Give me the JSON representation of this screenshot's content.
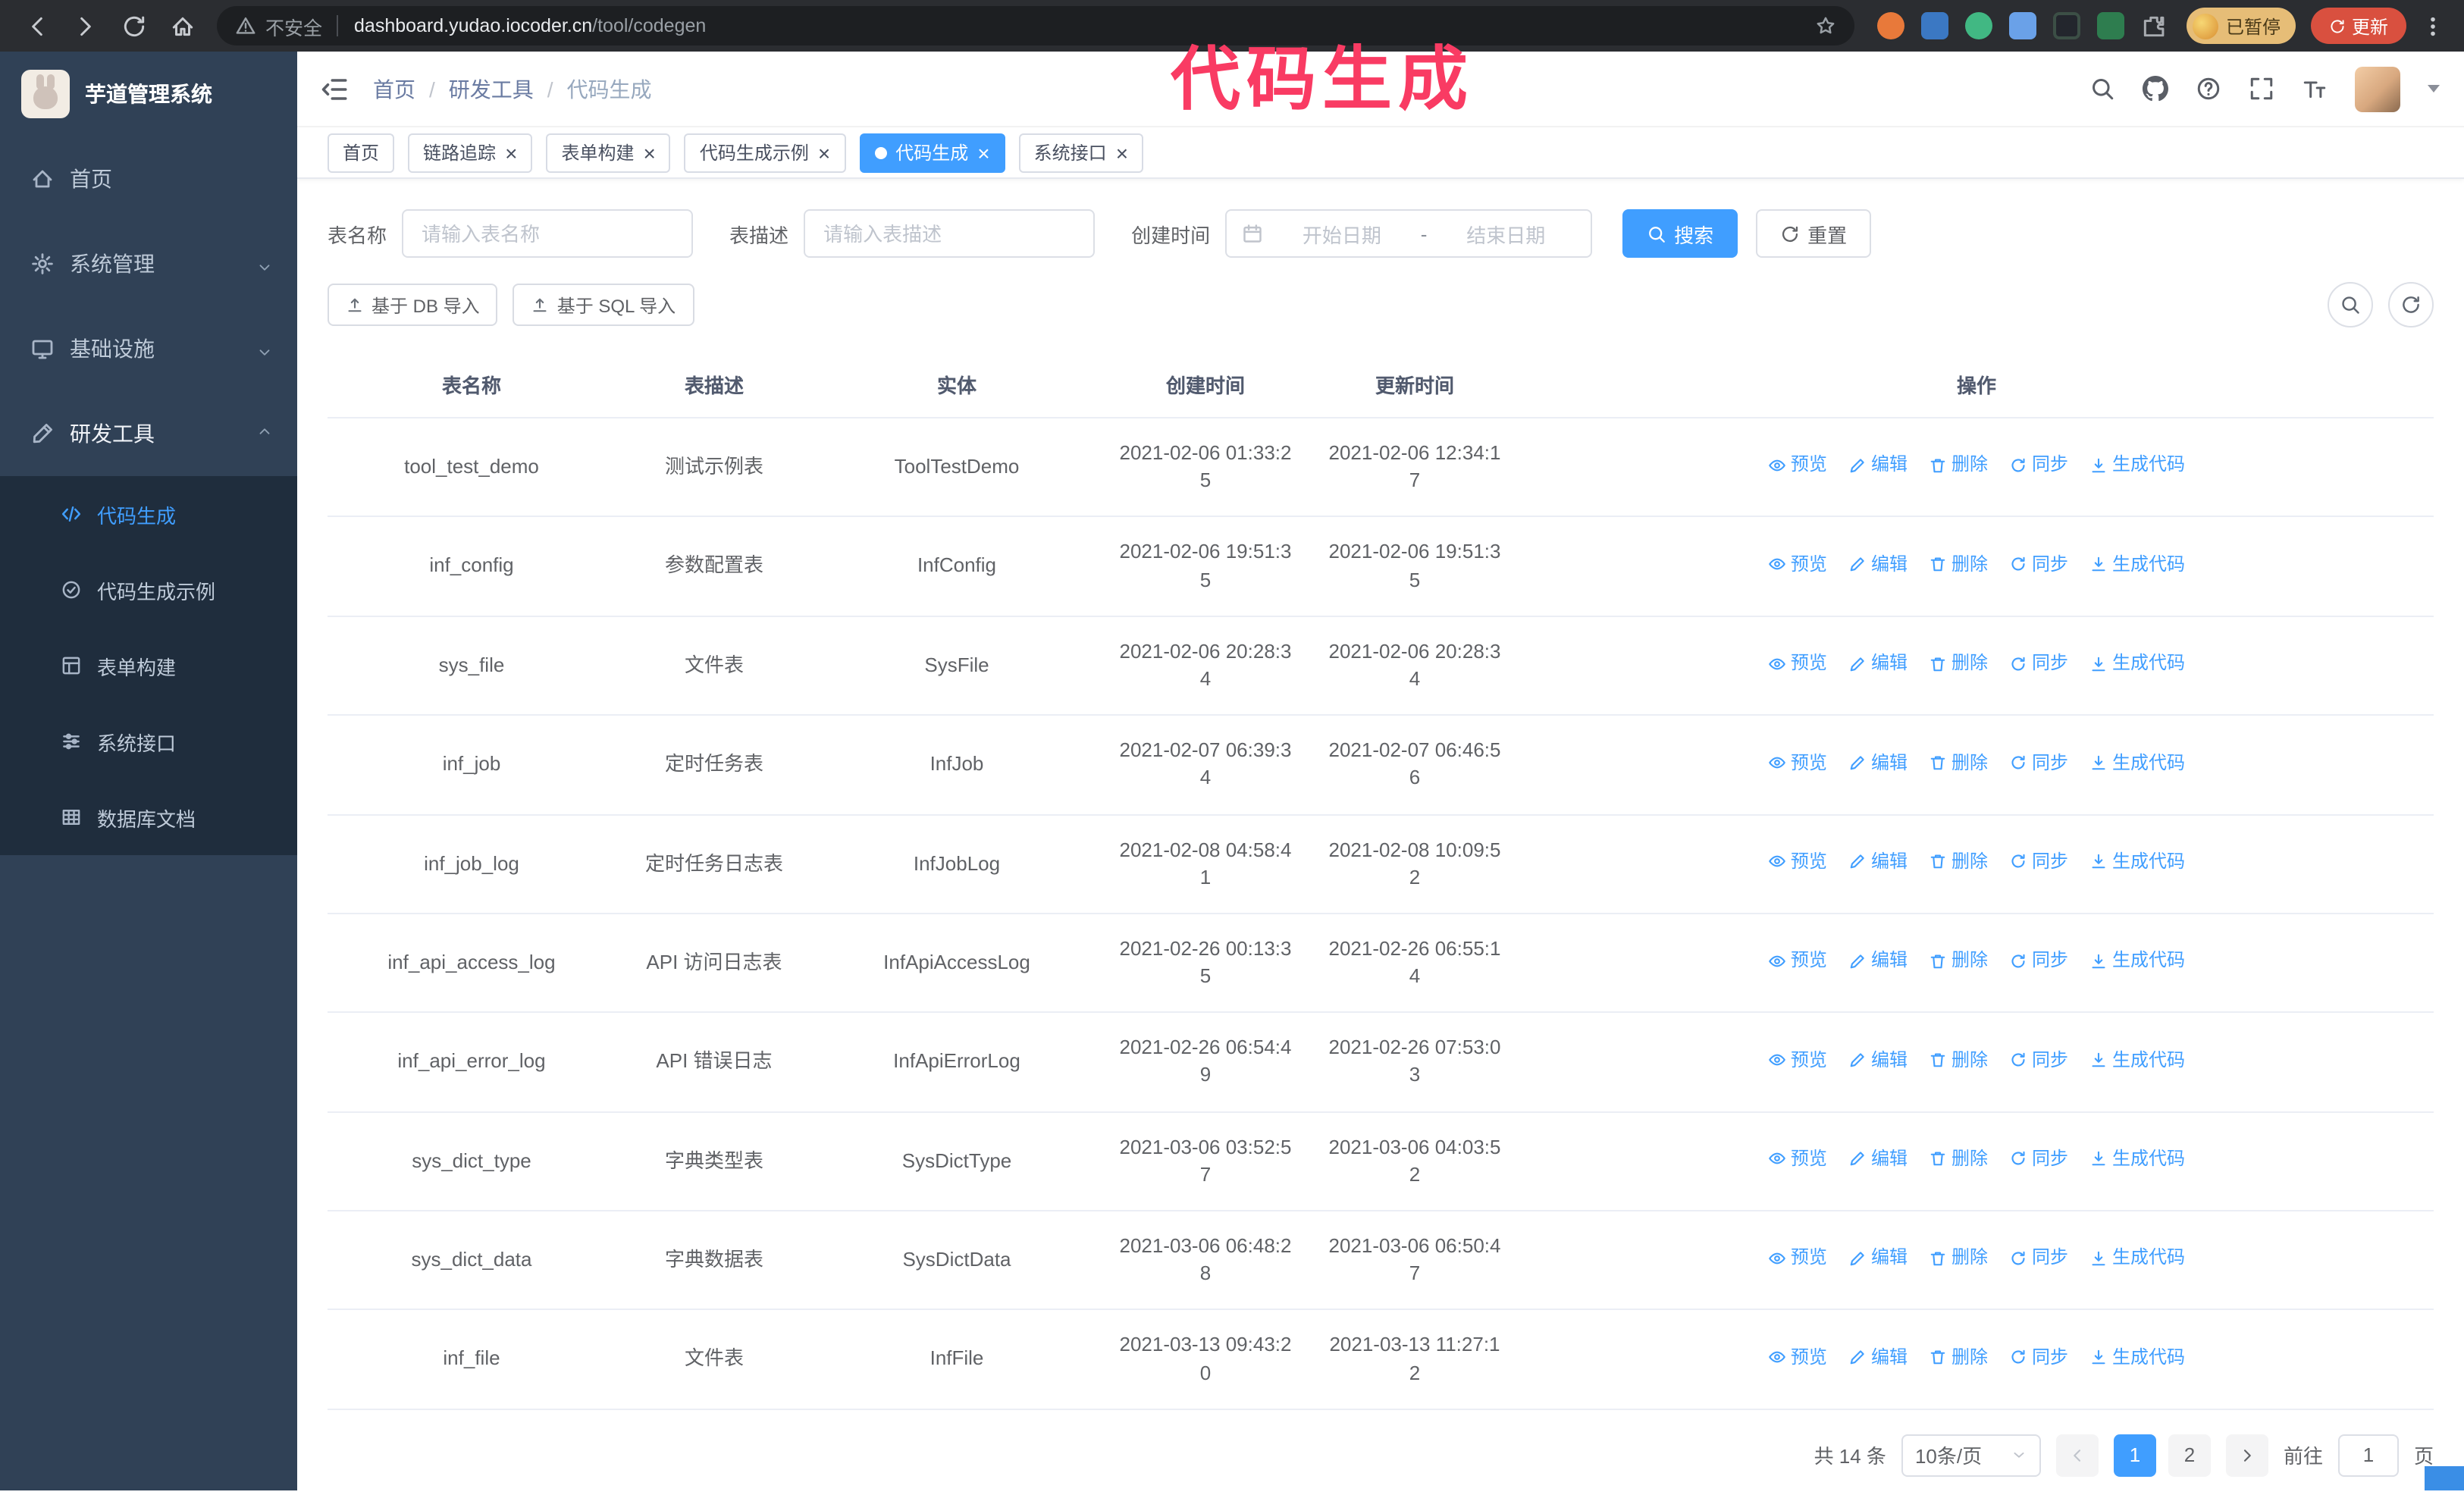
{
  "browser": {
    "security_label": "不安全",
    "url_domain": "dashboard.yudao.iocoder.cn",
    "url_path": "/tool/codegen",
    "profile_badge": "已暂停",
    "update_label": "更新"
  },
  "annotation": {
    "text": "代码生成",
    "color": "#f93b63"
  },
  "sidebar": {
    "title": "芋道管理系统",
    "items": [
      {
        "key": "home",
        "label": "首页",
        "icon": "home-icon",
        "expandable": false,
        "expanded": false
      },
      {
        "key": "system",
        "label": "系统管理",
        "icon": "gear-icon",
        "expandable": true,
        "expanded": false
      },
      {
        "key": "infra",
        "label": "基础设施",
        "icon": "monitor-icon",
        "expandable": true,
        "expanded": false
      },
      {
        "key": "dev-tools",
        "label": "研发工具",
        "icon": "tools-icon",
        "expandable": true,
        "expanded": true
      }
    ],
    "sub_items": [
      {
        "key": "codegen",
        "label": "代码生成",
        "icon": "code-icon",
        "active": true
      },
      {
        "key": "codegen-example",
        "label": "代码生成示例",
        "icon": "example-icon",
        "active": false
      },
      {
        "key": "form-builder",
        "label": "表单构建",
        "icon": "form-icon",
        "active": false
      },
      {
        "key": "system-api",
        "label": "系统接口",
        "icon": "api-icon",
        "active": false
      },
      {
        "key": "db-doc",
        "label": "数据库文档",
        "icon": "db-doc-icon",
        "active": false
      }
    ]
  },
  "navbar": {
    "breadcrumb": [
      "首页",
      "研发工具",
      "代码生成"
    ]
  },
  "tabs": [
    {
      "key": "home",
      "label": "首页",
      "closable": false,
      "active": false
    },
    {
      "key": "tracer",
      "label": "链路追踪",
      "closable": true,
      "active": false
    },
    {
      "key": "form-builder",
      "label": "表单构建",
      "closable": true,
      "active": false
    },
    {
      "key": "codegen-example",
      "label": "代码生成示例",
      "closable": true,
      "active": false
    },
    {
      "key": "codegen",
      "label": "代码生成",
      "closable": true,
      "active": true
    },
    {
      "key": "system-api",
      "label": "系统接口",
      "closable": true,
      "active": false
    }
  ],
  "filters": {
    "table_name_label": "表名称",
    "table_name_placeholder": "请输入表名称",
    "table_desc_label": "表描述",
    "table_desc_placeholder": "请输入表描述",
    "create_time_label": "创建时间",
    "date_start_placeholder": "开始日期",
    "date_separator": "-",
    "date_end_placeholder": "结束日期",
    "search_label": "搜索",
    "reset_label": "重置"
  },
  "toolbar": {
    "import_db_label": "基于 DB 导入",
    "import_sql_label": "基于 SQL 导入"
  },
  "table": {
    "columns": [
      "表名称",
      "表描述",
      "实体",
      "创建时间",
      "更新时间",
      "操作"
    ],
    "actions": [
      {
        "key": "preview",
        "label": "预览",
        "icon": "eye-icon"
      },
      {
        "key": "edit",
        "label": "编辑",
        "icon": "edit-icon"
      },
      {
        "key": "delete",
        "label": "删除",
        "icon": "delete-icon"
      },
      {
        "key": "sync",
        "label": "同步",
        "icon": "sync-icon"
      },
      {
        "key": "generate",
        "label": "生成代码",
        "icon": "download-icon"
      }
    ],
    "rows": [
      {
        "name": "tool_test_demo",
        "desc": "测试示例表",
        "entity": "ToolTestDemo",
        "create_time": "2021-02-06 01:33:25",
        "update_time": "2021-02-06 12:34:17"
      },
      {
        "name": "inf_config",
        "desc": "参数配置表",
        "entity": "InfConfig",
        "create_time": "2021-02-06 19:51:35",
        "update_time": "2021-02-06 19:51:35"
      },
      {
        "name": "sys_file",
        "desc": "文件表",
        "entity": "SysFile",
        "create_time": "2021-02-06 20:28:34",
        "update_time": "2021-02-06 20:28:34"
      },
      {
        "name": "inf_job",
        "desc": "定时任务表",
        "entity": "InfJob",
        "create_time": "2021-02-07 06:39:34",
        "update_time": "2021-02-07 06:46:56"
      },
      {
        "name": "inf_job_log",
        "desc": "定时任务日志表",
        "entity": "InfJobLog",
        "create_time": "2021-02-08 04:58:41",
        "update_time": "2021-02-08 10:09:52"
      },
      {
        "name": "inf_api_access_log",
        "desc": "API 访问日志表",
        "entity": "InfApiAccessLog",
        "create_time": "2021-02-26 00:13:35",
        "update_time": "2021-02-26 06:55:14"
      },
      {
        "name": "inf_api_error_log",
        "desc": "API 错误日志",
        "entity": "InfApiErrorLog",
        "create_time": "2021-02-26 06:54:49",
        "update_time": "2021-02-26 07:53:03"
      },
      {
        "name": "sys_dict_type",
        "desc": "字典类型表",
        "entity": "SysDictType",
        "create_time": "2021-03-06 03:52:57",
        "update_time": "2021-03-06 04:03:52"
      },
      {
        "name": "sys_dict_data",
        "desc": "字典数据表",
        "entity": "SysDictData",
        "create_time": "2021-03-06 06:48:28",
        "update_time": "2021-03-06 06:50:47"
      },
      {
        "name": "inf_file",
        "desc": "文件表",
        "entity": "InfFile",
        "create_time": "2021-03-13 09:43:20",
        "update_time": "2021-03-13 11:27:12"
      }
    ]
  },
  "pagination": {
    "total_text": "共 14 条",
    "page_size": "10条/页",
    "pages": [
      "1",
      "2"
    ],
    "active_page": "1",
    "jump_prefix": "前往",
    "jump_value": "1",
    "jump_suffix": "页"
  },
  "colors": {
    "accent": "#409eff",
    "sidebar_bg": "#304156",
    "submenu_bg": "#1f2d3d",
    "annotation": "#f93b63"
  }
}
